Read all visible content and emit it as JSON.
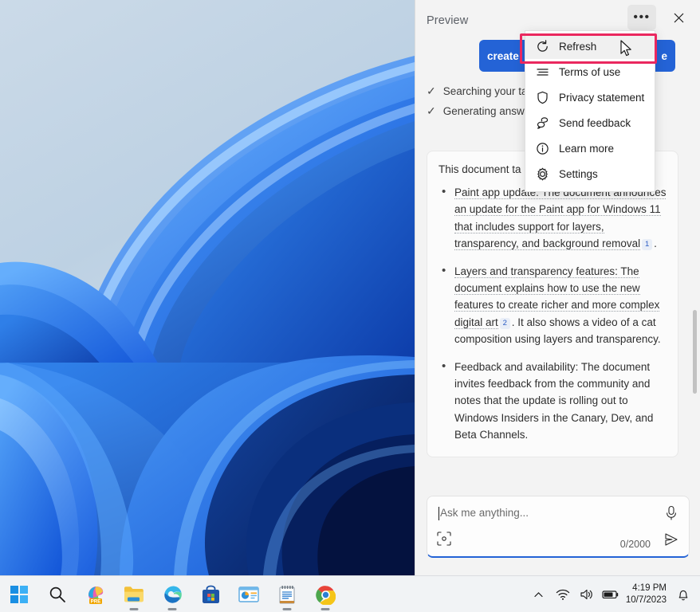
{
  "panel": {
    "title": "Preview",
    "more_button": "…",
    "close_button": "✕",
    "buttons": {
      "create_label": "create",
      "summarize_label": "e"
    },
    "status": [
      {
        "check": "✓",
        "text": "Searching your tab..."
      },
      {
        "check": "✓",
        "text": "Generating answ"
      }
    ],
    "answer": {
      "intro": "This document ta",
      "bullets": [
        {
          "cited_text": "Paint app update: The document announces an update for the Paint app for Windows 11 that includes support for layers, transparency, and background removal",
          "citation": "1",
          "tail": ".",
          "plain": ""
        },
        {
          "cited_text": "Layers and transparency features: The document explains how to use the new features to create richer and more complex digital art",
          "citation": "2",
          "tail": ". It also shows a video of a cat composition using layers and transparency.",
          "plain": ""
        },
        {
          "cited_text": "",
          "citation": "",
          "tail": "",
          "plain": "Feedback and availability: The document invites feedback from the community and notes that the update is rolling out to Windows Insiders in the Canary, Dev, and Beta Channels."
        }
      ]
    },
    "composer": {
      "placeholder": "Ask me anything...",
      "counter": "0/2000",
      "mic_icon": "microphone-icon",
      "scan_icon": "scan-image-icon",
      "send_icon": "send-icon"
    }
  },
  "context_menu": {
    "items": [
      {
        "label": "Refresh",
        "icon": "refresh-icon",
        "highlighted": true
      },
      {
        "label": "Terms of use",
        "icon": "list-lines-icon",
        "highlighted": false
      },
      {
        "label": "Privacy statement",
        "icon": "shield-icon",
        "highlighted": false
      },
      {
        "label": "Send feedback",
        "icon": "feedback-icon",
        "highlighted": false
      },
      {
        "label": "Learn more",
        "icon": "info-circle-icon",
        "highlighted": false
      },
      {
        "label": "Settings",
        "icon": "gear-icon",
        "highlighted": false
      }
    ],
    "highlight_color": "#ea285f"
  },
  "taskbar": {
    "icons": [
      {
        "name": "start-button",
        "running": false
      },
      {
        "name": "search-button",
        "running": false
      },
      {
        "name": "paint-pre-app",
        "running": false
      },
      {
        "name": "file-explorer",
        "running": true
      },
      {
        "name": "microsoft-edge",
        "running": true
      },
      {
        "name": "microsoft-store",
        "running": false
      },
      {
        "name": "powerpoint-app",
        "running": false
      },
      {
        "name": "notepad-app",
        "running": true
      },
      {
        "name": "google-chrome",
        "running": true
      }
    ],
    "tray": {
      "chevron": "⌃",
      "wifi_icon": "wifi-icon",
      "volume_icon": "speaker-icon",
      "battery_icon": "battery-icon",
      "time": "4:19 PM",
      "date": "10/7/2023",
      "notification_icon": "bell-icon"
    }
  },
  "colors": {
    "accent_blue": "#2463d6",
    "highlight_pink": "#ea285f",
    "panel_bg": "#f3f3f3",
    "taskbar_bg": "#f1f3f5"
  }
}
